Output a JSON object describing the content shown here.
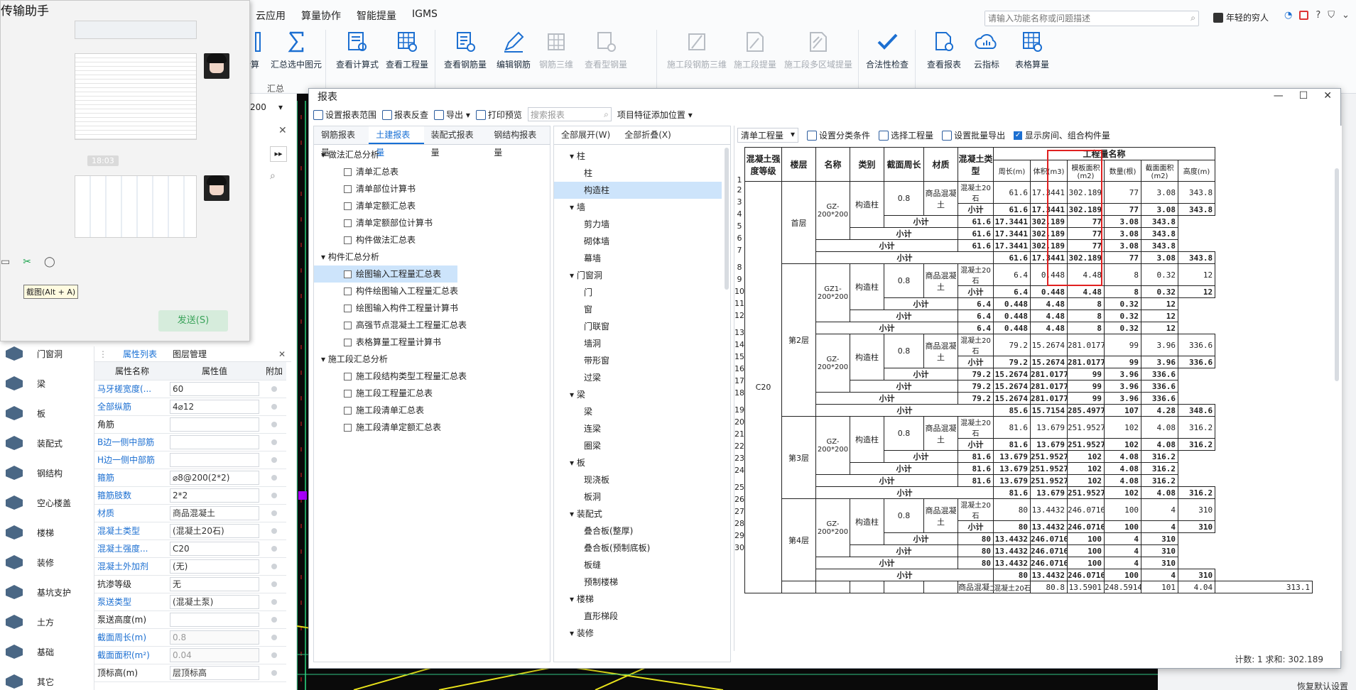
{
  "chat": {
    "title": "传输助手",
    "time": "18:03",
    "tooltip": "截图(Alt + A)",
    "send": "发送(S)"
  },
  "menu": [
    "云应用",
    "算量协作",
    "智能提量",
    "IGMS"
  ],
  "search": {
    "placeholder": "请输入功能名称或问题描述"
  },
  "user": "年轻的穷人",
  "right_icons": [
    "?"
  ],
  "ribbon_tools": [
    {
      "label": "计算",
      "disabled": false
    },
    {
      "label": "汇总选中图元",
      "disabled": false
    },
    {
      "label": "查看计算式",
      "disabled": false
    },
    {
      "label": "查看工程量",
      "disabled": false
    },
    {
      "label": "查看钢筋量",
      "disabled": false
    },
    {
      "label": "编辑钢筋",
      "disabled": false
    },
    {
      "label": "钢筋三维",
      "disabled": true
    },
    {
      "label": "查看型钢量",
      "disabled": true
    },
    {
      "label": "施工段钢筋三维",
      "disabled": true
    },
    {
      "label": "施工段提量",
      "disabled": true
    },
    {
      "label": "施工段多区域提量",
      "disabled": true
    },
    {
      "label": "合法性检查",
      "disabled": false
    },
    {
      "label": "查看报表",
      "disabled": false
    },
    {
      "label": "云指标",
      "disabled": false
    },
    {
      "label": "表格算量",
      "disabled": false
    }
  ],
  "ribbon_group": "汇总",
  "floor_value": "200",
  "report": {
    "title": "报表",
    "toolbar": [
      "设置报表范围",
      "报表反查",
      "导出",
      "打印预览"
    ],
    "toolbar_search": "搜索报表",
    "toolbar_extra": "项目特征添加位置",
    "tabs": [
      "钢筋报表量",
      "土建报表量",
      "装配式报表量",
      "钢结构报表量"
    ],
    "active_tab": 1,
    "tree": [
      {
        "label": "做法汇总分析",
        "level": 0
      },
      {
        "label": "清单汇总表",
        "level": 1
      },
      {
        "label": "清单部位计算书",
        "level": 1
      },
      {
        "label": "清单定额汇总表",
        "level": 1
      },
      {
        "label": "清单定额部位计算书",
        "level": 1
      },
      {
        "label": "构件做法汇总表",
        "level": 1
      },
      {
        "label": "构件汇总分析",
        "level": 0
      },
      {
        "label": "绘图输入工程量汇总表",
        "level": 1,
        "selected": true
      },
      {
        "label": "构件绘图输入工程量汇总表",
        "level": 1
      },
      {
        "label": "绘图输入构件工程量计算书",
        "level": 1
      },
      {
        "label": "高强节点混凝土工程量汇总表",
        "level": 1
      },
      {
        "label": "表格算量工程量计算书",
        "level": 1
      },
      {
        "label": "施工段汇总分析",
        "level": 0
      },
      {
        "label": "施工段结构类型工程量汇总表",
        "level": 1
      },
      {
        "label": "施工段工程量汇总表",
        "level": 1
      },
      {
        "label": "施工段清单汇总表",
        "level": 1
      },
      {
        "label": "施工段清单定额汇总表",
        "level": 1
      }
    ],
    "expand_all": "全部展开(W)",
    "collapse_all": "全部折叠(X)",
    "cat_tree": [
      {
        "label": "柱",
        "level": 0
      },
      {
        "label": "柱",
        "level": 1
      },
      {
        "label": "构造柱",
        "level": 1,
        "selected": true
      },
      {
        "label": "墙",
        "level": 0
      },
      {
        "label": "剪力墙",
        "level": 1
      },
      {
        "label": "砌体墙",
        "level": 1
      },
      {
        "label": "幕墙",
        "level": 1
      },
      {
        "label": "门窗洞",
        "level": 0
      },
      {
        "label": "门",
        "level": 1
      },
      {
        "label": "窗",
        "level": 1
      },
      {
        "label": "门联窗",
        "level": 1
      },
      {
        "label": "墙洞",
        "level": 1
      },
      {
        "label": "带形窗",
        "level": 1
      },
      {
        "label": "过梁",
        "level": 1
      },
      {
        "label": "梁",
        "level": 0
      },
      {
        "label": "梁",
        "level": 1
      },
      {
        "label": "连梁",
        "level": 1
      },
      {
        "label": "圈梁",
        "level": 1
      },
      {
        "label": "板",
        "level": 0
      },
      {
        "label": "现浇板",
        "level": 1
      },
      {
        "label": "板洞",
        "level": 1
      },
      {
        "label": "装配式",
        "level": 0
      },
      {
        "label": "叠合板(整厚)",
        "level": 1
      },
      {
        "label": "叠合板(预制底板)",
        "level": 1
      },
      {
        "label": "板缝",
        "level": 1
      },
      {
        "label": "预制楼梯",
        "level": 1
      },
      {
        "label": "楼梯",
        "level": 0
      },
      {
        "label": "直形梯段",
        "level": 1
      },
      {
        "label": "装修",
        "level": 0
      }
    ],
    "right_toolbar": {
      "dropdown": "清单工程量",
      "set_cond": "设置分类条件",
      "select_proj": "选择工程量",
      "batch_export": "设置批量导出",
      "show_room": "显示房间、组合构件量"
    },
    "headers": {
      "grade": "混凝土强度等级",
      "floor": "楼层",
      "name": "名称",
      "type": "类别",
      "perim": "截面周长",
      "mat": "材质",
      "ctype": "混凝土类型",
      "group": "工程量名称",
      "cols": [
        "周长(m)",
        "体积(m3)",
        "模板面积(m2)",
        "数量(根)",
        "截面面积(m2)",
        "高度(m)"
      ]
    },
    "grade_value": "C20",
    "subtotal": "小计",
    "blocks": [
      {
        "floor": "首层",
        "name": "GZ-200*200",
        "type": "构造柱",
        "perim": "0.8",
        "mat": "商品混凝土",
        "ctype": "混凝土20石",
        "values": [
          "61.6",
          "17.3441",
          "302.189",
          "77",
          "3.08",
          "343.8"
        ]
      },
      {
        "floor": "第2层",
        "name": "GZ1-200*200",
        "type": "构造柱",
        "perim": "0.8",
        "mat": "商品混凝土",
        "ctype": "混凝土20石",
        "values": [
          "6.4",
          "0.448",
          "4.48",
          "8",
          "0.32",
          "12"
        ]
      },
      {
        "floor": "第2层",
        "name": "GZ-200*200",
        "type": "构造柱",
        "perim": "0.8",
        "mat": "商品混凝土",
        "ctype": "混凝土20石",
        "values": [
          "79.2",
          "15.2674",
          "281.0177",
          "99",
          "3.96",
          "336.6"
        ]
      },
      {
        "floor": "第3层",
        "name": "GZ-200*200",
        "type": "构造柱",
        "perim": "0.8",
        "mat": "商品混凝土",
        "ctype": "混凝土20石",
        "values": [
          "81.6",
          "13.679",
          "251.9527",
          "102",
          "4.08",
          "316.2"
        ]
      },
      {
        "floor": "第4层",
        "name": "GZ-200*200",
        "type": "构造柱",
        "perim": "0.8",
        "mat": "商品混凝土",
        "ctype": "混凝土20石",
        "values": [
          "80",
          "13.4432",
          "246.0716",
          "100",
          "4",
          "310"
        ]
      }
    ],
    "floor2_total": [
      "85.6",
      "15.7154",
      "285.4977",
      "107",
      "4.28",
      "348.6"
    ],
    "last_row": [
      "80.8",
      "13.5901",
      "248.5914",
      "101",
      "4.04",
      "313.1"
    ],
    "status": "计数: 1  求和: 302.189"
  },
  "props": {
    "tabs": [
      "属性列表",
      "图层管理"
    ],
    "headers": [
      "属性名称",
      "属性值",
      "附加"
    ],
    "rows": [
      {
        "name": "马牙槎宽度(...",
        "value": "60",
        "link": true
      },
      {
        "name": "全部纵筋",
        "value": "4⌀12",
        "link": true
      },
      {
        "name": "角筋",
        "value": "",
        "link": false
      },
      {
        "name": "B边一侧中部筋",
        "value": "",
        "link": true
      },
      {
        "name": "H边一侧中部筋",
        "value": "",
        "link": true
      },
      {
        "name": "箍筋",
        "value": "⌀8@200(2*2)",
        "link": true
      },
      {
        "name": "箍筋肢数",
        "value": "2*2",
        "link": true
      },
      {
        "name": "材质",
        "value": "商品混凝土",
        "link": true
      },
      {
        "name": "混凝土类型",
        "value": "(混凝土20石)",
        "link": true
      },
      {
        "name": "混凝土强度...",
        "value": "C20",
        "link": true
      },
      {
        "name": "混凝土外加剂",
        "value": "(无)",
        "link": true
      },
      {
        "name": "抗渗等级",
        "value": "无",
        "link": false
      },
      {
        "name": "泵送类型",
        "value": "(混凝土泵)",
        "link": true
      },
      {
        "name": "泵送高度(m)",
        "value": "",
        "link": false
      },
      {
        "name": "截面周长(m)",
        "value": "0.8",
        "link": true,
        "ro": true
      },
      {
        "name": "截面面积(m²)",
        "value": "0.04",
        "link": true,
        "ro": true
      },
      {
        "name": "顶标高(m)",
        "value": "层顶标高",
        "link": false
      }
    ]
  },
  "side_items": [
    "门窗洞",
    "梁",
    "板",
    "装配式",
    "钢结构",
    "空心楼盖",
    "楼梯",
    "装修",
    "基坑支护",
    "土方",
    "基础",
    "其它"
  ],
  "bottom_right": "恢复默认设置"
}
